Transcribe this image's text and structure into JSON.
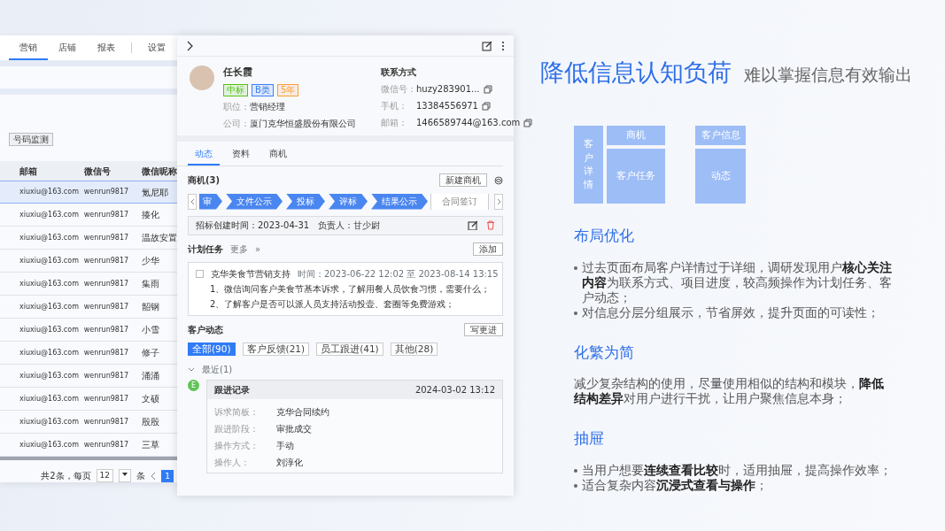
{
  "nav_tabs": [
    {
      "label": "营销",
      "selected": true
    },
    {
      "label": "店铺",
      "selected": false
    },
    {
      "label": "报表",
      "selected": false
    },
    {
      "label": "设置",
      "selected": false
    }
  ],
  "toolbar_buttons": [
    "号码监测"
  ],
  "table": {
    "columns": [
      "邮箱",
      "微信号",
      "微信昵称"
    ],
    "rows": [
      {
        "cells": [
          "xiuxiu@163.com",
          "wenrun9817",
          "氪尼耶"
        ],
        "selected": true
      },
      {
        "cells": [
          "xiuxiu@163.com",
          "wenrun9817",
          "揍化"
        ],
        "selected": false
      },
      {
        "cells": [
          "xiuxiu@163.com",
          "wenrun9817",
          "温故安置"
        ],
        "selected": false
      },
      {
        "cells": [
          "xiuxiu@163.com",
          "wenrun9817",
          "少华"
        ],
        "selected": false
      },
      {
        "cells": [
          "xiuxiu@163.com",
          "wenrun9817",
          "集雨"
        ],
        "selected": false
      },
      {
        "cells": [
          "xiuxiu@163.com",
          "wenrun9817",
          "韶钢"
        ],
        "selected": false
      },
      {
        "cells": [
          "xiuxiu@163.com",
          "wenrun9817",
          "小雪"
        ],
        "selected": false
      },
      {
        "cells": [
          "xiuxiu@163.com",
          "wenrun9817",
          "修子"
        ],
        "selected": false
      },
      {
        "cells": [
          "xiuxiu@163.com",
          "wenrun9817",
          "涌涌"
        ],
        "selected": false
      },
      {
        "cells": [
          "xiuxiu@163.com",
          "wenrun9817",
          "文硕"
        ],
        "selected": false
      },
      {
        "cells": [
          "xiuxiu@163.com",
          "wenrun9817",
          "殷殷"
        ],
        "selected": false
      },
      {
        "cells": [
          "xiuxiu@163.com",
          "wenrun9817",
          "三草"
        ],
        "selected": false
      }
    ]
  },
  "pagination": {
    "summary": "共2条，每页",
    "page_size": "12",
    "unit": "条",
    "pages": [
      {
        "label": "1",
        "selected": true
      }
    ]
  },
  "drawer": {
    "profile": {
      "name": "任长霞",
      "tags": [
        {
          "label": "中标",
          "color": "#52c41a"
        },
        {
          "label": "B类",
          "color": "#3b7ff5"
        },
        {
          "label": "5年",
          "color": "#fa9d3b"
        }
      ],
      "fields": [
        {
          "label": "职位：",
          "value": "营销经理"
        },
        {
          "label": "公司：",
          "value": "厦门克华恒盛股份有限公司"
        }
      ]
    },
    "contact": {
      "title": "联系方式",
      "fields": [
        {
          "label": "微信号：",
          "value": "huzy283901..."
        },
        {
          "label": "手机：",
          "value": "13384556971"
        },
        {
          "label": "邮箱：",
          "value": "1466589744@163.com"
        }
      ]
    },
    "tabs": [
      {
        "label": "动态",
        "selected": true
      },
      {
        "label": "资料",
        "selected": false
      },
      {
        "label": "商机",
        "selected": false
      }
    ],
    "opportunity": {
      "title": "商机(3)",
      "button": "新建商机",
      "stages": [
        {
          "label": "审",
          "done": true
        },
        {
          "label": "文件公示",
          "done": true
        },
        {
          "label": "投标",
          "done": true
        },
        {
          "label": "评标",
          "done": true
        },
        {
          "label": "结果公示",
          "done": true
        },
        {
          "label": "合同签订",
          "done": false
        }
      ],
      "created": "招标创建时间：2023-04-31",
      "owner": "负责人：甘少尉"
    },
    "tasks": {
      "title": "计划任务",
      "more": "更多",
      "more_icon": "»",
      "button": "添加",
      "items": [
        {
          "checked": false,
          "title": "克华美食节营销支持",
          "time": "时间：2023-06-22 12:02 至 2023-08-14 13:15",
          "notes": [
            "1、微信询问客户美食节基本诉求，了解用餐人员饮食习惯，需要什么；",
            "2、了解客户是否可以派人员支持活动投壶、套圈等免费游戏；"
          ]
        }
      ]
    },
    "activity": {
      "title": "客户动态",
      "button": "写更进",
      "filters": [
        {
          "label": "全部(90)",
          "selected": true
        },
        {
          "label": "客户反馈(21)",
          "selected": false
        },
        {
          "label": "员工跟进(41)",
          "selected": false
        },
        {
          "label": "其他(28)",
          "selected": false
        }
      ],
      "group": {
        "label": "最近(1)",
        "expanded": true
      },
      "records": [
        {
          "avatar": "E",
          "title": "跟进记录",
          "time": "2024-03-02 13:12",
          "fields": [
            {
              "label": "诉求简板：",
              "value": "克华合同续约"
            },
            {
              "label": "跟进阶段：",
              "value": "审批成交"
            },
            {
              "label": "操作方式：",
              "value": "手动"
            },
            {
              "label": "操作人：",
              "value": "刘淳化"
            }
          ]
        }
      ]
    }
  },
  "slide": {
    "title": "降低信息认知负荷",
    "subtitle": "难以掌握信息有效输出",
    "diagram": [
      {
        "side": "客户详情",
        "top": "商机",
        "main": "客户任务"
      },
      {
        "top": "客户信息",
        "main": "动态"
      }
    ],
    "sections": [
      {
        "heading": "布局优化",
        "kind": "bullets",
        "items": [
          "过去页面布局客户详情过于详细，调研发现用户**核心关注内容**为联系方式、项目进度，较高频操作为计划任务、客户动态；",
          "对信息分层分组展示，节省屏效，提升页面的可读性；"
        ]
      },
      {
        "heading": "化繁为简",
        "kind": "paragraph",
        "text": "减少复杂结构的使用，尽量使用相似的结构和模块，**降低结构差异**对用户进行干扰，让用户聚焦信息本身；"
      },
      {
        "heading": "抽屉",
        "kind": "bullets",
        "items": [
          "当用户想要**连续查看比较**时，适用抽屉，提高操作效率；",
          "适合复杂内容**沉浸式查看与操作**；"
        ]
      }
    ]
  }
}
